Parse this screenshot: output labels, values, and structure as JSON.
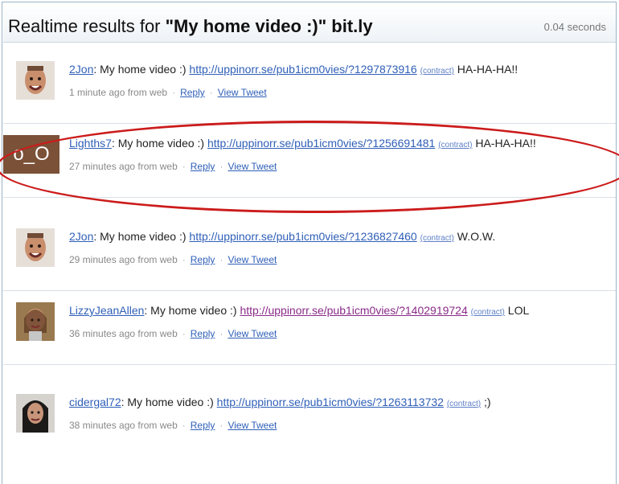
{
  "header": {
    "title_prefix": "Realtime results for ",
    "title_query": "\"My home video :)\" bit.ly",
    "elapsed": "0.04 seconds"
  },
  "tweets": [
    {
      "user": "2Jon",
      "text": ": My home video :) ",
      "url": "http://uppinorr.se/pub1icm0vies/?1297873916",
      "contract": "(contract)",
      "suffix": " HA-HA-HA!!",
      "time": "1 minute ago from web",
      "reply": "Reply",
      "view": "View Tweet",
      "avatar": "smiling-man-avatar",
      "url_state": "normal"
    },
    {
      "user": "Lighths7",
      "text": ": My home video :) ",
      "url": "http://uppinorr.se/pub1icm0vies/?1256691481",
      "contract": "(contract)",
      "suffix": " HA-HA-HA!!",
      "time": "27 minutes ago from web",
      "reply": "Reply",
      "view": "View Tweet",
      "avatar": "o_O",
      "url_state": "normal"
    },
    {
      "user": "2Jon",
      "text": ": My home video :) ",
      "url": "http://uppinorr.se/pub1icm0vies/?1236827460",
      "contract": "(contract)",
      "suffix": " W.O.W.",
      "time": "29 minutes ago from web",
      "reply": "Reply",
      "view": "View Tweet",
      "avatar": "smiling-man-avatar",
      "url_state": "normal"
    },
    {
      "user": "LizzyJeanAllen",
      "text": ": My home video :) ",
      "url": "http://uppinorr.se/pub1icm0vies/?1402919724",
      "contract": "(contract)",
      "suffix": " LOL",
      "time": "36 minutes ago from web",
      "reply": "Reply",
      "view": "View Tweet",
      "avatar": "woman-avatar",
      "url_state": "visited"
    },
    {
      "user": "cidergal72",
      "text": ": My home video :) ",
      "url": "http://uppinorr.se/pub1icm0vies/?1263113732",
      "contract": "(contract)",
      "suffix": " ;)",
      "time": "38 minutes ago from web",
      "reply": "Reply",
      "view": "View Tweet",
      "avatar": "woman-dark-hair-avatar",
      "url_state": "normal"
    }
  ]
}
